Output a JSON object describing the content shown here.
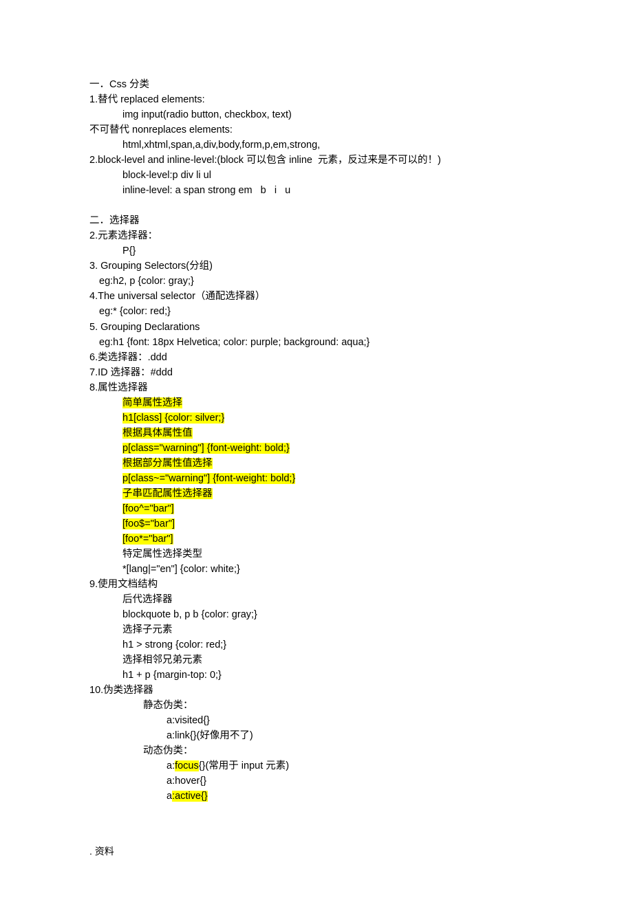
{
  "lines": [
    {
      "cls": "",
      "parts": [
        {
          "t": "一．Css 分类"
        }
      ]
    },
    {
      "cls": "",
      "parts": [
        {
          "t": "1.替代 replaced elements:"
        }
      ]
    },
    {
      "cls": "indent1",
      "parts": [
        {
          "t": "img input(radio button, checkbox, text)"
        }
      ]
    },
    {
      "cls": "",
      "parts": [
        {
          "t": "不可替代 nonreplaces elements:"
        }
      ]
    },
    {
      "cls": "indent1",
      "parts": [
        {
          "t": "html,xhtml,span,a,div,body,form,p,em,strong,"
        }
      ]
    },
    {
      "cls": "",
      "parts": [
        {
          "t": "2.block-level and inline-level:(block 可以包含 inline  元素，反过来是不可以的！)"
        }
      ]
    },
    {
      "cls": "indent1",
      "parts": [
        {
          "t": "block-level:p div li ul"
        }
      ]
    },
    {
      "cls": "indent1",
      "parts": [
        {
          "t": "inline-level: a span strong em   b   i   u"
        }
      ]
    },
    {
      "cls": "",
      "parts": [
        {
          "t": " "
        }
      ]
    },
    {
      "cls": "",
      "parts": [
        {
          "t": "二．选择器"
        }
      ]
    },
    {
      "cls": "",
      "parts": [
        {
          "t": "2.元素选择器："
        }
      ]
    },
    {
      "cls": "indent1",
      "parts": [
        {
          "t": "P{}"
        }
      ]
    },
    {
      "cls": "",
      "parts": [
        {
          "t": "3. Grouping Selectors(分组)"
        }
      ]
    },
    {
      "cls": "indent0a",
      "parts": [
        {
          "t": "eg:h2, p {color: gray;}"
        }
      ]
    },
    {
      "cls": "",
      "parts": [
        {
          "t": "4.The universal selector（通配选择器）"
        }
      ]
    },
    {
      "cls": "indent0a",
      "parts": [
        {
          "t": "eg:* {color: red;}"
        }
      ]
    },
    {
      "cls": "",
      "parts": [
        {
          "t": "5. Grouping Declarations"
        }
      ]
    },
    {
      "cls": "indent0a",
      "parts": [
        {
          "t": "eg:h1 {font: 18px Helvetica; color: purple; background: aqua;}"
        }
      ]
    },
    {
      "cls": "",
      "parts": [
        {
          "t": "6.类选择器：.ddd"
        }
      ]
    },
    {
      "cls": "",
      "parts": [
        {
          "t": "7.ID 选择器：#ddd"
        }
      ]
    },
    {
      "cls": "",
      "parts": [
        {
          "t": "8.属性选择器"
        }
      ]
    },
    {
      "cls": "indent1",
      "parts": [
        {
          "t": "简单属性选择",
          "hl": true
        }
      ]
    },
    {
      "cls": "indent1",
      "parts": [
        {
          "t": "h1[class] {color: silver;}",
          "hl": true
        }
      ]
    },
    {
      "cls": "indent1",
      "parts": [
        {
          "t": "根据具体属性值",
          "hl": true
        }
      ]
    },
    {
      "cls": "indent1",
      "parts": [
        {
          "t": "p[class=\"warning\"] {font-weight: bold;}",
          "hl": true
        }
      ]
    },
    {
      "cls": "indent1",
      "parts": [
        {
          "t": "根据部分属性值选择",
          "hl": true
        }
      ]
    },
    {
      "cls": "indent1",
      "parts": [
        {
          "t": "p[class~=\"warning\"] {font-weight: bold;}",
          "hl": true
        }
      ]
    },
    {
      "cls": "indent1",
      "parts": [
        {
          "t": "子串匹配属性选择器",
          "hl": true
        }
      ]
    },
    {
      "cls": "indent1",
      "parts": [
        {
          "t": "[foo^=\"bar\"]",
          "hl": true
        }
      ]
    },
    {
      "cls": "indent1",
      "parts": [
        {
          "t": "[foo$=\"bar\"]",
          "hl": true
        }
      ]
    },
    {
      "cls": "indent1",
      "parts": [
        {
          "t": "[foo*=\"bar\"]",
          "hl": true
        }
      ]
    },
    {
      "cls": "indent1",
      "parts": [
        {
          "t": "特定属性选择类型"
        }
      ]
    },
    {
      "cls": "indent1",
      "parts": [
        {
          "t": "*[lang|=\"en\"] {color: white;}"
        }
      ]
    },
    {
      "cls": "",
      "parts": [
        {
          "t": "9.使用文档结构"
        }
      ]
    },
    {
      "cls": "indent1",
      "parts": [
        {
          "t": "后代选择器"
        }
      ]
    },
    {
      "cls": "indent1",
      "parts": [
        {
          "t": "blockquote b, p b {color: gray;}"
        }
      ]
    },
    {
      "cls": "indent1",
      "parts": [
        {
          "t": "选择子元素"
        }
      ]
    },
    {
      "cls": "indent1",
      "parts": [
        {
          "t": "h1 > strong {color: red;}"
        }
      ]
    },
    {
      "cls": "indent1",
      "parts": [
        {
          "t": "选择相邻兄弟元素"
        }
      ]
    },
    {
      "cls": "indent1",
      "parts": [
        {
          "t": "h1 + p {margin-top: 0;}"
        }
      ]
    },
    {
      "cls": "",
      "parts": [
        {
          "t": "10.伪类选择器"
        }
      ]
    },
    {
      "cls": "indent2",
      "parts": [
        {
          "t": "静态伪类："
        }
      ]
    },
    {
      "cls": "indent3",
      "parts": [
        {
          "t": "a:visited{}"
        }
      ]
    },
    {
      "cls": "indent3",
      "parts": [
        {
          "t": "a:link{}(好像用不了)"
        }
      ]
    },
    {
      "cls": "indent2",
      "parts": [
        {
          "t": "动态伪类："
        }
      ]
    },
    {
      "cls": "indent3",
      "parts": [
        {
          "t": "a:"
        },
        {
          "t": "focus",
          "hl": true
        },
        {
          "t": "{}(常用于 input 元素)"
        }
      ]
    },
    {
      "cls": "indent3",
      "parts": [
        {
          "t": "a:hover{}"
        }
      ]
    },
    {
      "cls": "indent3",
      "parts": [
        {
          "t": "a"
        },
        {
          "t": ":active{}",
          "hl": true
        }
      ]
    }
  ],
  "footer": ". 资料"
}
